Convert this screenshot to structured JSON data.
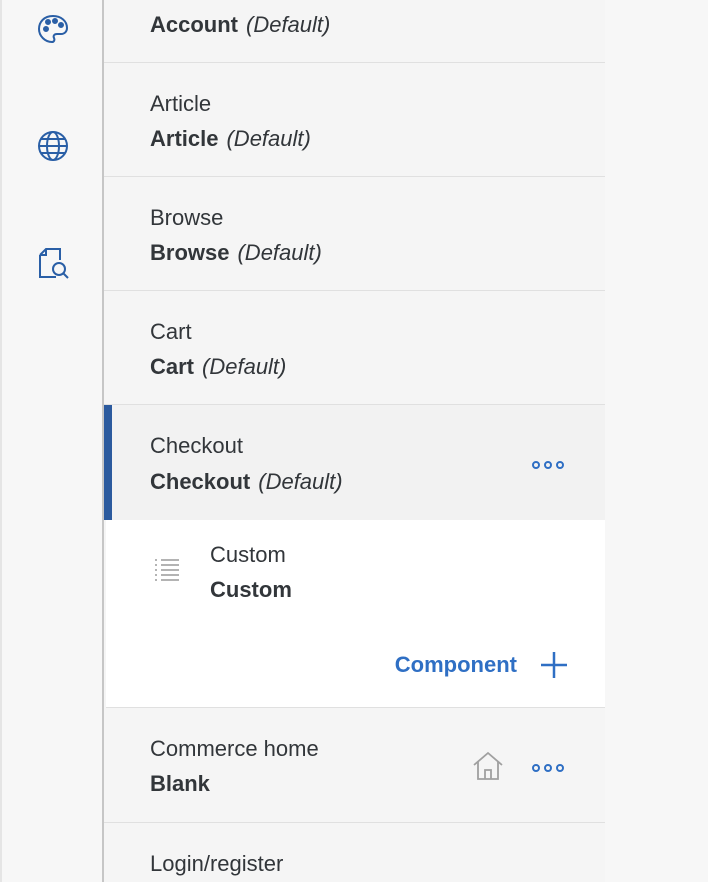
{
  "rail": {
    "icons": [
      "palette-icon",
      "globe-icon",
      "document-search-icon"
    ]
  },
  "pages": [
    {
      "title": "",
      "template": "Account",
      "default_tag": "(Default)"
    },
    {
      "title": "Article",
      "template": "Article",
      "default_tag": "(Default)"
    },
    {
      "title": "Browse",
      "template": "Browse",
      "default_tag": "(Default)"
    },
    {
      "title": "Cart",
      "template": "Cart",
      "default_tag": "(Default)"
    },
    {
      "title": "Checkout",
      "template": "Checkout",
      "default_tag": "(Default)",
      "selected": true
    },
    {
      "title": "Commerce home",
      "template": "Blank",
      "is_home": true
    },
    {
      "title": "Login/register",
      "template": ""
    }
  ],
  "checkout_children": {
    "component_title": "Custom",
    "component_template": "Custom",
    "add_component_label": "Component"
  },
  "colors": {
    "accent": "#2f6fc4",
    "selection_bar": "#2b5a9e",
    "icon_blue": "#2a5fa6"
  }
}
